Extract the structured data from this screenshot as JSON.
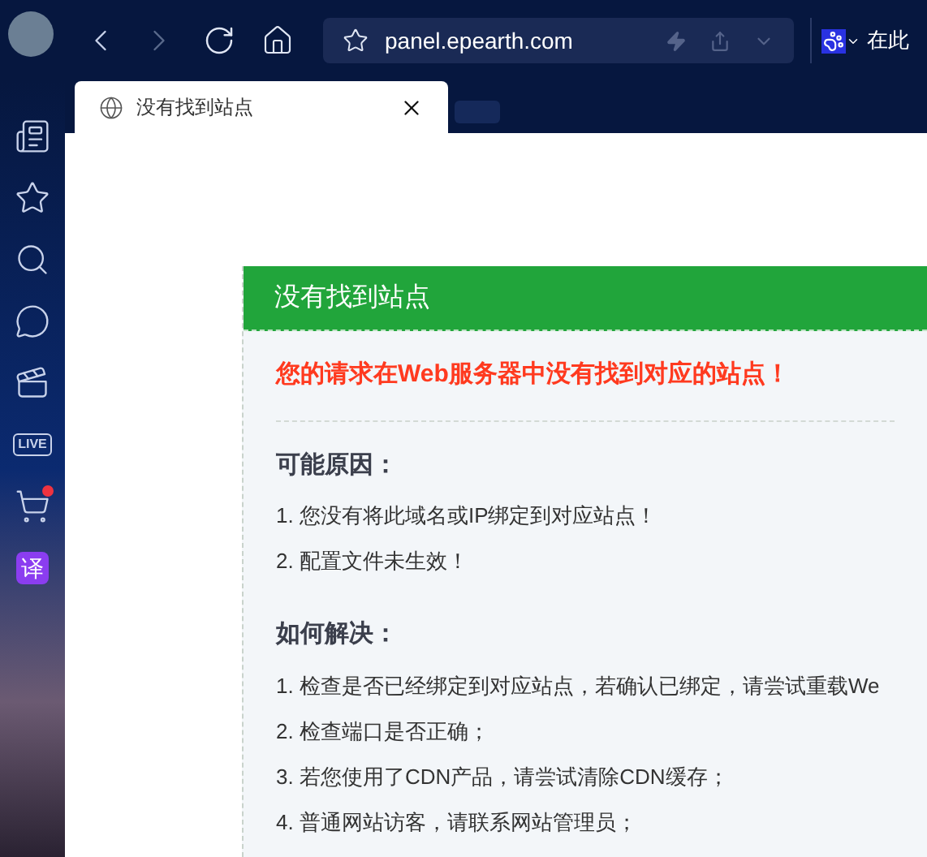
{
  "toolbar": {
    "url": "panel.epearth.com",
    "search_placeholder": "在此"
  },
  "tabs": [
    {
      "title": "没有找到站点",
      "selected": true
    }
  ],
  "sidebar": {
    "items": [
      {
        "kind": "news"
      },
      {
        "kind": "star"
      },
      {
        "kind": "search"
      },
      {
        "kind": "chat"
      },
      {
        "kind": "video"
      },
      {
        "kind": "live",
        "label": "LIVE"
      },
      {
        "kind": "cart",
        "badge": true
      },
      {
        "kind": "translate",
        "label": "译"
      }
    ]
  },
  "card": {
    "title": "没有找到站点",
    "error": "您的请求在Web服务器中没有找到对应的站点！",
    "sections": [
      {
        "heading": "可能原因：",
        "items": [
          "1. 您没有将此域名或IP绑定到对应站点！",
          "2. 配置文件未生效！"
        ]
      },
      {
        "heading": "如何解决：",
        "items": [
          "1. 检查是否已经绑定到对应站点，若确认已绑定，请尝试重载We",
          "2. 检查端口是否正确；",
          "3. 若您使用了CDN产品，请尝试清除CDN缓存；",
          "4. 普通网站访客，请联系网站管理员；"
        ]
      }
    ]
  }
}
